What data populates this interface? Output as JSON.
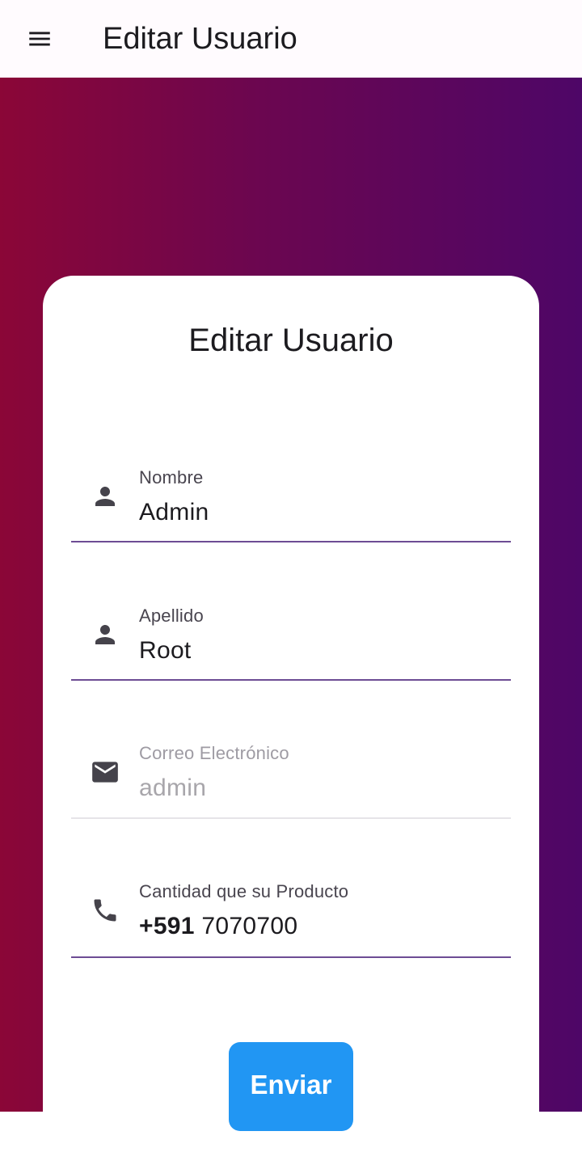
{
  "appbar": {
    "title": "Editar Usuario",
    "menu_icon": "menu-icon"
  },
  "colors": {
    "gradient_start": "#8b0637",
    "gradient_end": "#4e0667",
    "accent_underline": "#6d4c94",
    "button": "#2196f3"
  },
  "form": {
    "title": "Editar Usuario",
    "fields": [
      {
        "label": "Nombre",
        "value": "Admin",
        "icon": "person-icon",
        "enabled": true
      },
      {
        "label": "Apellido",
        "value": "Root",
        "icon": "person-icon",
        "enabled": true
      },
      {
        "label": "Correo Electrónico",
        "value": "admin",
        "icon": "email-icon",
        "enabled": false
      },
      {
        "label": "Cantidad que su Producto",
        "prefix": "+591",
        "value": "7070700",
        "icon": "phone-icon",
        "enabled": true
      }
    ],
    "submit_label": "Enviar"
  }
}
